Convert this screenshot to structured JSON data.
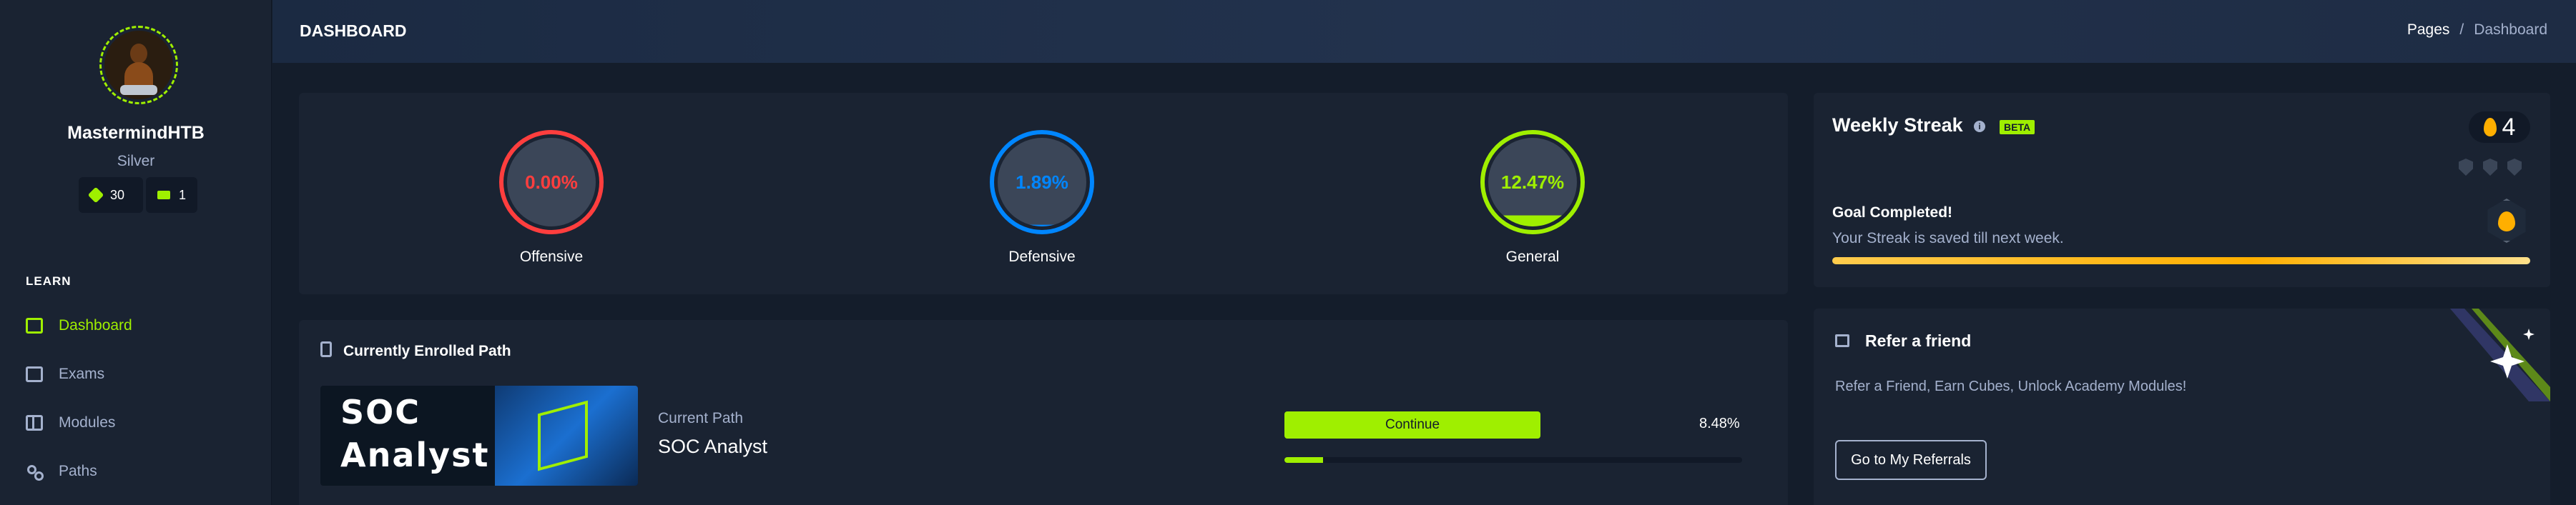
{
  "sidebar": {
    "username": "MastermindHTB",
    "rank": "Silver",
    "cubes": "30",
    "vouchers": "1",
    "section_label": "LEARN",
    "items": [
      {
        "label": "Dashboard",
        "icon": "dashboard-icon",
        "active": true
      },
      {
        "label": "Exams",
        "icon": "exams-icon",
        "active": false
      },
      {
        "label": "Modules",
        "icon": "modules-icon",
        "active": false
      },
      {
        "label": "Paths",
        "icon": "paths-icon",
        "active": false
      }
    ]
  },
  "header": {
    "title": "DASHBOARD",
    "breadcrumb": [
      "Pages",
      "/",
      "Dashboard"
    ]
  },
  "skills": [
    {
      "label": "Offensive",
      "value_text": "0.00%",
      "value": 0.0,
      "color": "#ff3e3e"
    },
    {
      "label": "Defensive",
      "value_text": "1.89%",
      "value": 1.89,
      "color": "#0086ff"
    },
    {
      "label": "General",
      "value_text": "12.47%",
      "value": 12.47,
      "color": "#9fef00"
    }
  ],
  "enrolled_path": {
    "title": "Currently Enrolled Path",
    "banner_line1": "SOC",
    "banner_line2": "Analyst",
    "current_label": "Current Path",
    "current_name": "SOC Analyst",
    "continue_label": "Continue",
    "progress_text": "8.48%",
    "progress": 8.48
  },
  "weekly_streak": {
    "title": "Weekly Streak",
    "badge": "BETA",
    "info_icon": "info-icon",
    "count": "4",
    "goal_title": "Goal Completed!",
    "goal_text": "Your Streak is saved till next week.",
    "accent": "#ffaf00"
  },
  "refer": {
    "title": "Refer a friend",
    "description": "Refer a Friend, Earn Cubes, Unlock Academy Modules!",
    "button_label": "Go to My Referrals"
  },
  "colors": {
    "bg": "#141d2b",
    "card": "#1a2332",
    "accent": "#9fef00",
    "muted": "#a4b1cd"
  }
}
